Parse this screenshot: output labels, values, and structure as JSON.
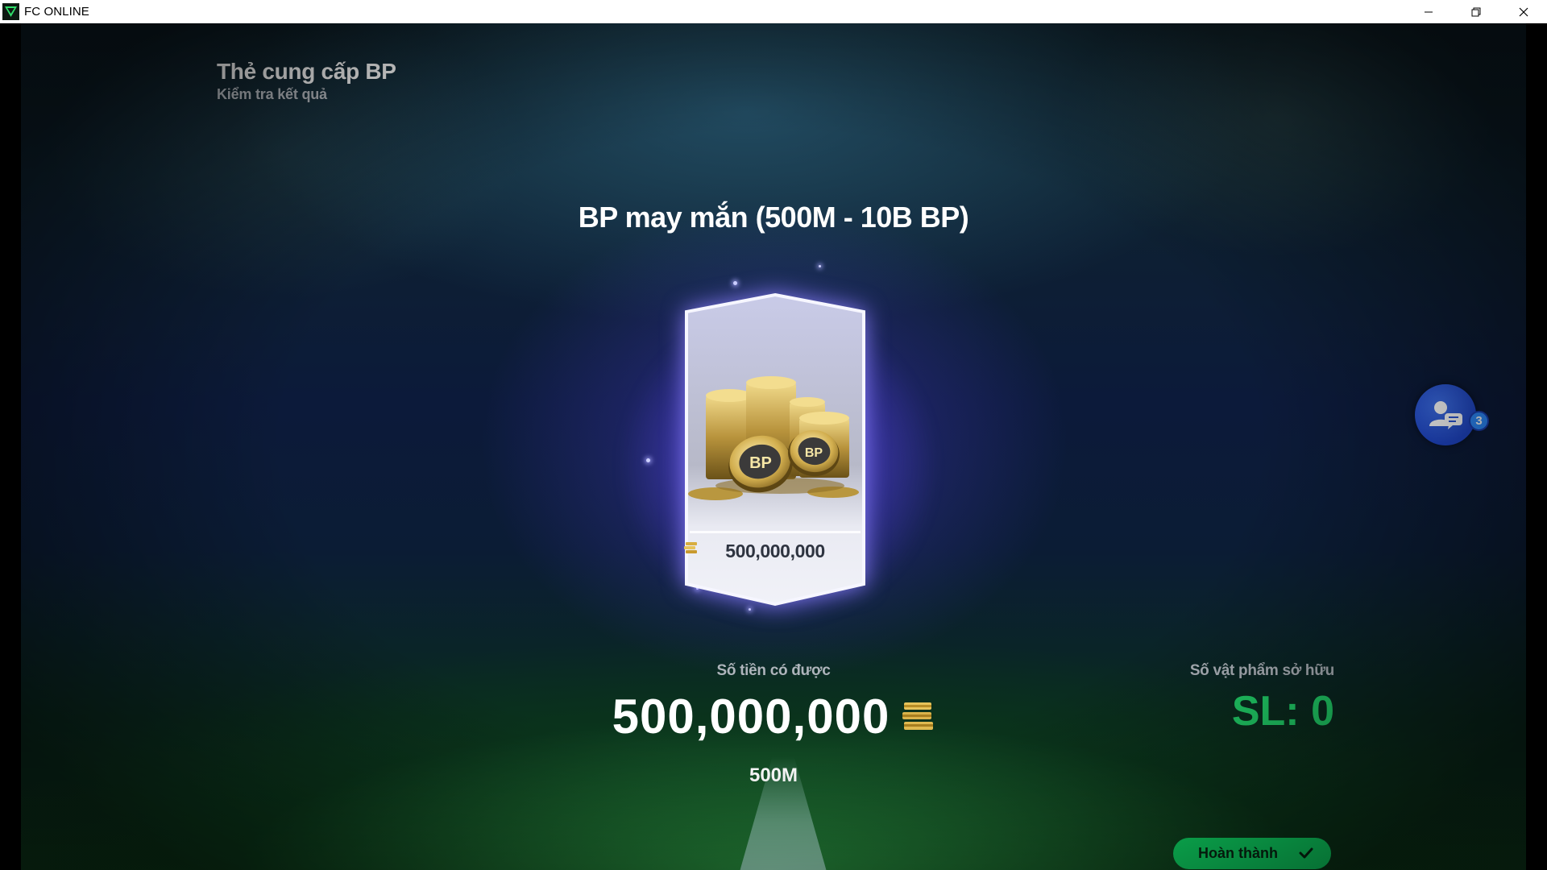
{
  "window": {
    "title": "FC ONLINE",
    "controls": [
      "minimize-icon",
      "restore-icon",
      "close-icon"
    ]
  },
  "header": {
    "title": "Thẻ cung cấp BP",
    "subtitle": "Kiểm tra kết quả"
  },
  "pack": {
    "name": "BP may mắn (500M - 10B BP)",
    "card_value": "500,000,000",
    "card_coin_labels": [
      "BP",
      "BP"
    ]
  },
  "result": {
    "earned_label": "Số tiền có được",
    "earned_amount": "500,000,000",
    "earned_short": "500M"
  },
  "inventory": {
    "owned_label": "Số vật phẩm sở hữu",
    "owned_count": "SL: 0"
  },
  "actions": {
    "complete_label": "Hoàn thành"
  },
  "chat": {
    "badge_count": "3"
  },
  "colors": {
    "accent_green": "#0ff06f",
    "count_green": "#21d46a",
    "chat_blue": "#2a55d6",
    "card_glow": "#7a6cff"
  }
}
